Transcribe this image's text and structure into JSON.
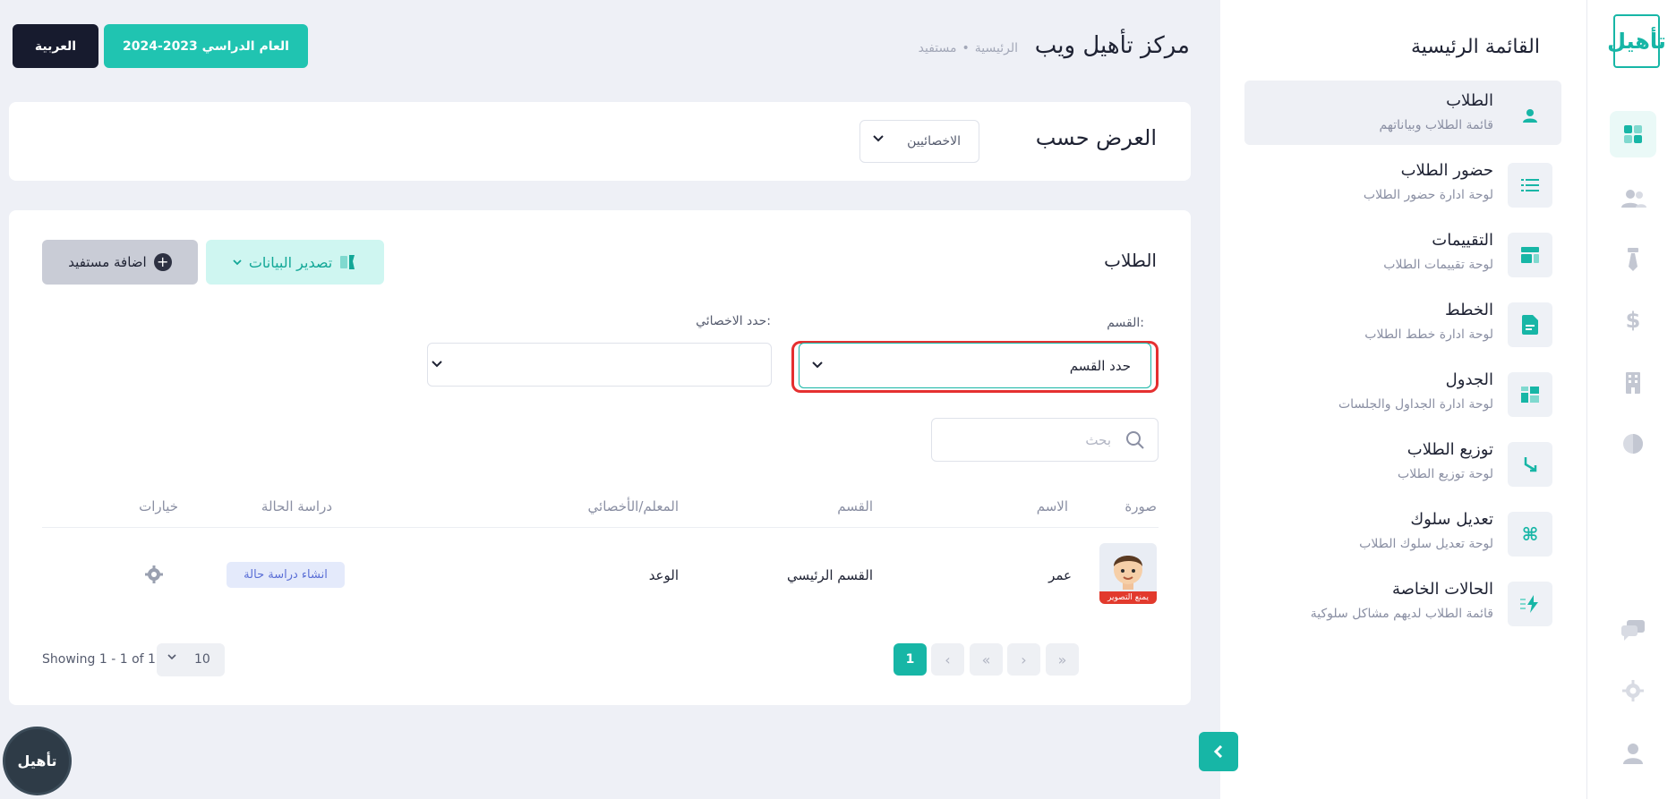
{
  "header": {
    "language_label": "العربية",
    "year_label": "العام الدراسي 2023-2024",
    "page_title": "مركز تأهيل ويب",
    "breadcrumb": [
      "الرئيسية",
      "مستفيد"
    ]
  },
  "rail": {
    "logo_text": "تأهيل",
    "icons": [
      "dashboard-icon",
      "users-icon",
      "tie-icon",
      "dollar-icon",
      "building-icon",
      "globe-icon",
      "chat-icon",
      "gear-icon",
      "user-icon"
    ]
  },
  "menu": {
    "title": "القائمة الرئيسية",
    "items": [
      {
        "title": "الطلاب",
        "sub": "قائمة الطلاب وبياناتهم",
        "icon": "user-icon"
      },
      {
        "title": "حضور الطلاب",
        "sub": "لوحة ادارة حضور الطلاب",
        "icon": "list-icon"
      },
      {
        "title": "التقييمات",
        "sub": "لوحة تقييمات الطلاب",
        "icon": "layout-icon"
      },
      {
        "title": "الخطط",
        "sub": "لوحة ادارة خطط الطلاب",
        "icon": "document-icon"
      },
      {
        "title": "الجدول",
        "sub": "لوحة ادارة الجداول والجلسات",
        "icon": "schedule-icon"
      },
      {
        "title": "توزيع الطلاب",
        "sub": "لوحة توزيع الطلاب",
        "icon": "arrow-split-icon"
      },
      {
        "title": "تعديل سلوك",
        "sub": "لوحة تعديل سلوك الطلاب",
        "icon": "command-icon"
      },
      {
        "title": "الحالات الخاصة",
        "sub": "قائمة الطلاب لديهم مشاكل سلوكية",
        "icon": "lightning-icon"
      }
    ]
  },
  "filter": {
    "label": "العرض حسب",
    "selected": "الاخصائيين"
  },
  "students": {
    "title": "الطلاب",
    "export_label": "تصدير البيانات",
    "add_label": "اضافة مستفيد",
    "dept_label": "القسم:",
    "dept_value": "حدد القسم",
    "spec_label": "حدد الاخصائي:",
    "spec_value": "",
    "search_placeholder": "بحث",
    "columns": [
      "صورة",
      "الاسم",
      "القسم",
      "المعلم/الأخصائي",
      "دراسة الحالة",
      "خيارات"
    ],
    "rows": [
      {
        "avatar_badge": "يمنع التصوير",
        "name": "عمر",
        "department": "القسم الرئيسي",
        "specialist": "الوعد",
        "case_study": "انشاء دراسة حالة"
      }
    ],
    "pager": {
      "current": "1",
      "per_page": "10",
      "showing": "Showing 1 - 1 of 1"
    }
  },
  "colors": {
    "accent": "#17b6a6",
    "dark": "#171b2e",
    "highlight": "#e53030",
    "background": "#eef0f6"
  }
}
